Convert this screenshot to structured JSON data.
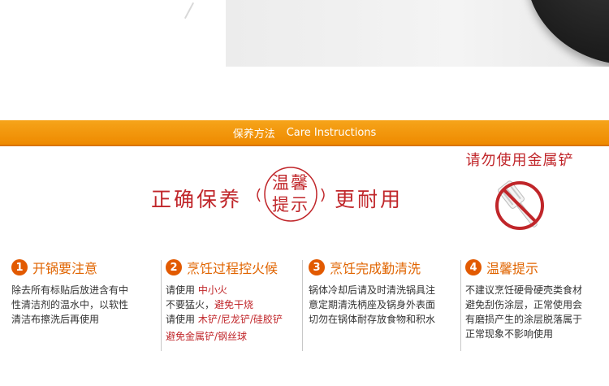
{
  "banner": {
    "title_cn": "保养方法",
    "title_en": "Care Instructions"
  },
  "warning": {
    "caption": "请勿使用金属铲",
    "icon": "no-metal-spatula-icon",
    "color": "#c0262a"
  },
  "heading": {
    "left": "正确保养",
    "badge_line1": "温馨",
    "badge_line2": "提示",
    "right": "更耐用"
  },
  "colors": {
    "accent": "#ee8a00",
    "number": "#e25a00",
    "title": "#e06400",
    "red": "#c0262a"
  },
  "columns": [
    {
      "number": "1",
      "title": "开锅要注意",
      "lines": [
        "除去所有标贴后放进含有中",
        "性清洁剂的温水中，以软性",
        "清洁布擦洗后再使用"
      ]
    },
    {
      "number": "2",
      "title": "烹饪过程控火候",
      "line1_label": "请使用",
      "line1_value": "中小火",
      "line2_label": "不要猛火，",
      "line2_value": "避免干烧",
      "line3_label": "请使用",
      "line3_value": "木铲/尼龙铲/硅胶铲",
      "line4_value": "避免金属铲/钢丝球"
    },
    {
      "number": "3",
      "title": "烹饪完成勤清洗",
      "lines": [
        "锅体冷却后请及时清洗锅具注",
        "意定期清洗柄座及锅身外表面",
        "切勿在锅体耐存放食物和积水"
      ]
    },
    {
      "number": "4",
      "title": "温馨提示",
      "lines": [
        "不建议烹饪硬骨硬壳类食材",
        "避免刮伤涂层，正常使用会",
        "有磨损产生的涂层脱落属于",
        "正常现象不影响使用"
      ]
    }
  ]
}
